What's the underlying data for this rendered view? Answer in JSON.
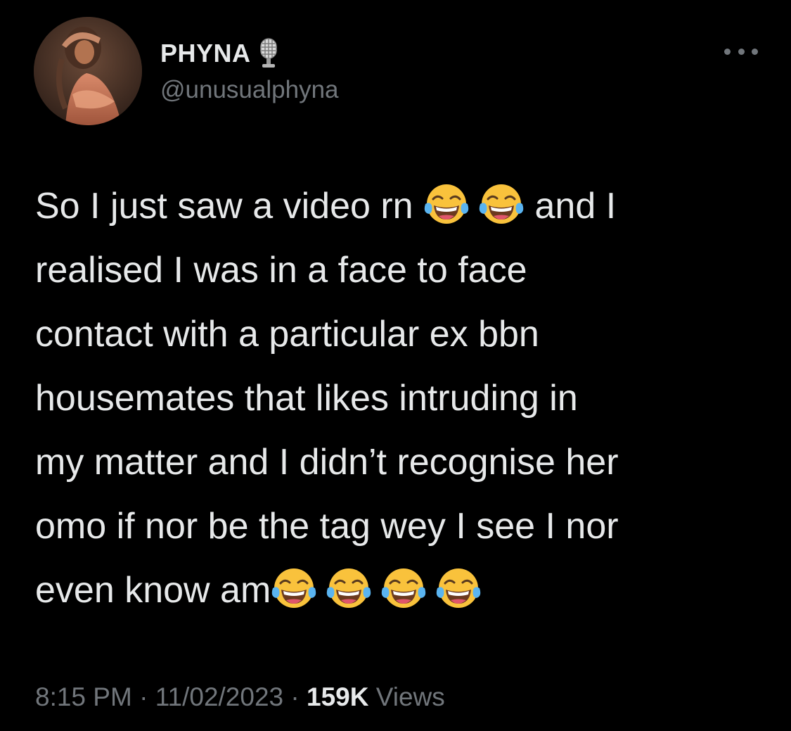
{
  "tweet": {
    "author": {
      "display_name": "PHYNA",
      "name_badge_icon": "microphone-icon",
      "handle": "@unusualphyna",
      "avatar_icon": "profile-photo"
    },
    "more_icon": "ellipsis-icon",
    "body_lines": [
      {
        "before": "So I just saw a video rn ",
        "emoji_count": 2,
        "after": " and I"
      },
      {
        "text": "realised I was in a face to face"
      },
      {
        "text": "contact with a particular ex bbn"
      },
      {
        "text": "housemates that likes intruding in"
      },
      {
        "text": "my matter and I didn’t recognise her"
      },
      {
        "text": "omo if nor be the tag wey I see I nor"
      },
      {
        "before": "even know am",
        "emoji_count": 4
      }
    ],
    "emoji": "face-with-tears-of-joy",
    "time": "8:15 PM",
    "separator": "·",
    "date": "11/02/2023",
    "views_count": "159K",
    "views_label": "Views"
  },
  "colors": {
    "background": "#000000",
    "primary_text": "#e7e9ea",
    "secondary_text": "#71767b",
    "emoji_face": "#f9c23c"
  }
}
